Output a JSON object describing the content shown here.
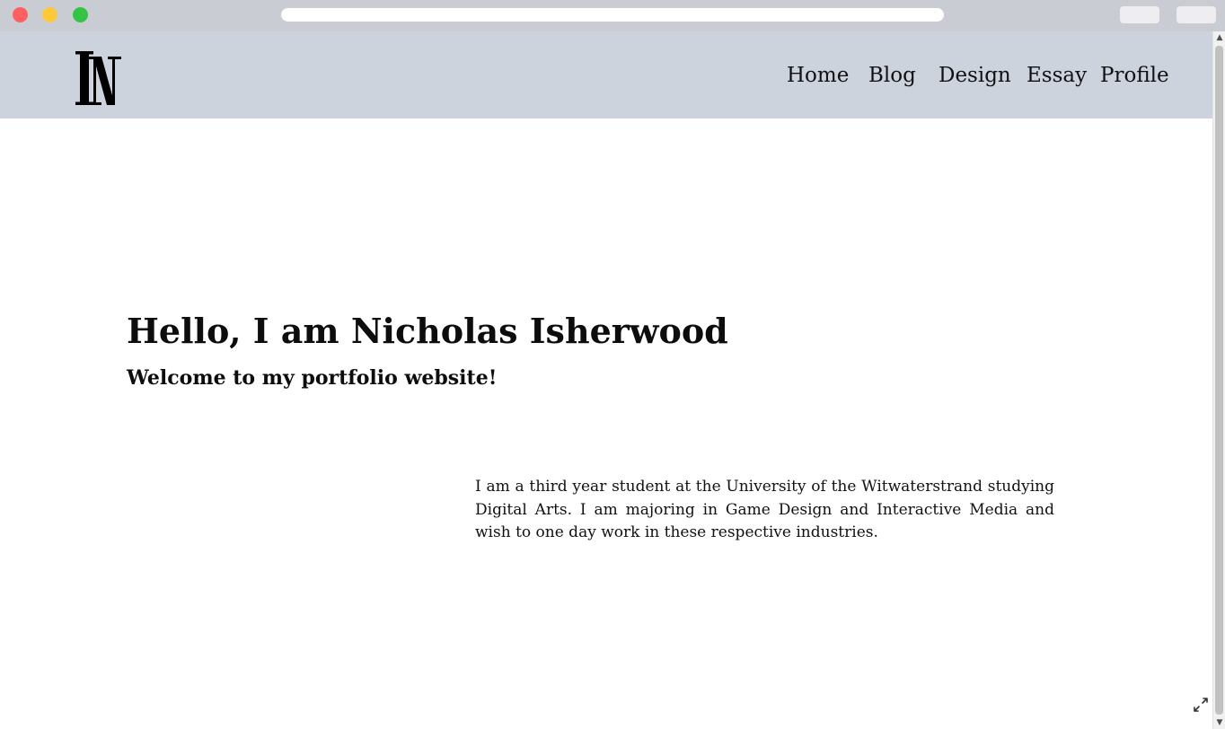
{
  "browser": {
    "window_controls": [
      "close",
      "minimize",
      "maximize"
    ],
    "address": ""
  },
  "header": {
    "logo_icon": "monogram-ni-logo",
    "nav": [
      {
        "label": "Home"
      },
      {
        "label": "Blog"
      },
      {
        "label": "Design"
      },
      {
        "label": "Essay"
      },
      {
        "label": "Profile"
      }
    ],
    "background_color": "#cdd3dd"
  },
  "hero": {
    "title": "Hello, I am Nicholas Isherwood",
    "subtitle": "Welcome to my portfolio website!"
  },
  "bio": {
    "text": "I am a third year student at the University of the Witwaterstrand studying Digital Arts. I am majoring in Game Design and Interactive Media and wish to one day work in these respective industries."
  },
  "icons": {
    "expand": "expand-icon",
    "scroll_up": "scroll-up-arrow-icon",
    "scroll_down": "scroll-down-arrow-icon"
  }
}
